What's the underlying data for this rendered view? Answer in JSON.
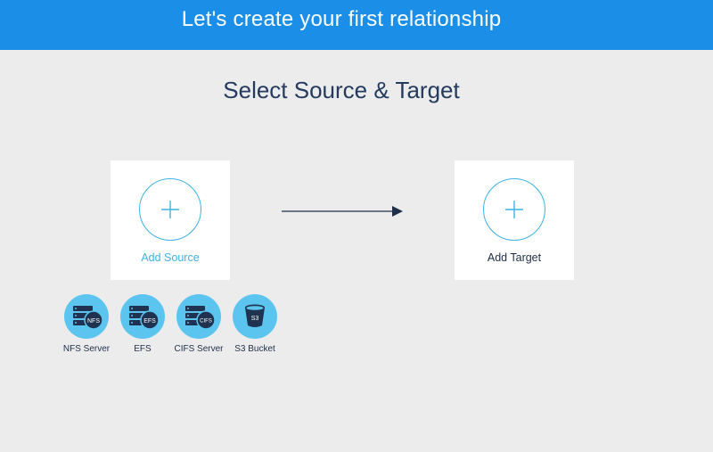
{
  "header": {
    "title": "Let's create your first relationship"
  },
  "main": {
    "section_title": "Select Source & Target",
    "source": {
      "label": "Add Source"
    },
    "target": {
      "label": "Add Target"
    },
    "endpoints": [
      {
        "label": "NFS Server",
        "badge": "NFS",
        "icon": "server-icon"
      },
      {
        "label": "EFS",
        "badge": "EFS",
        "icon": "server-icon"
      },
      {
        "label": "CIFS Server",
        "badge": "CIFS",
        "icon": "server-icon"
      },
      {
        "label": "S3 Bucket",
        "badge": "S3",
        "icon": "bucket-icon"
      }
    ]
  },
  "colors": {
    "header_bg": "#1b8ee8",
    "accent": "#3db2e6",
    "icon_bg": "#5bc5ef",
    "icon_dark": "#1f3350",
    "text_dark": "#243a5e",
    "page_bg": "#ececec"
  }
}
